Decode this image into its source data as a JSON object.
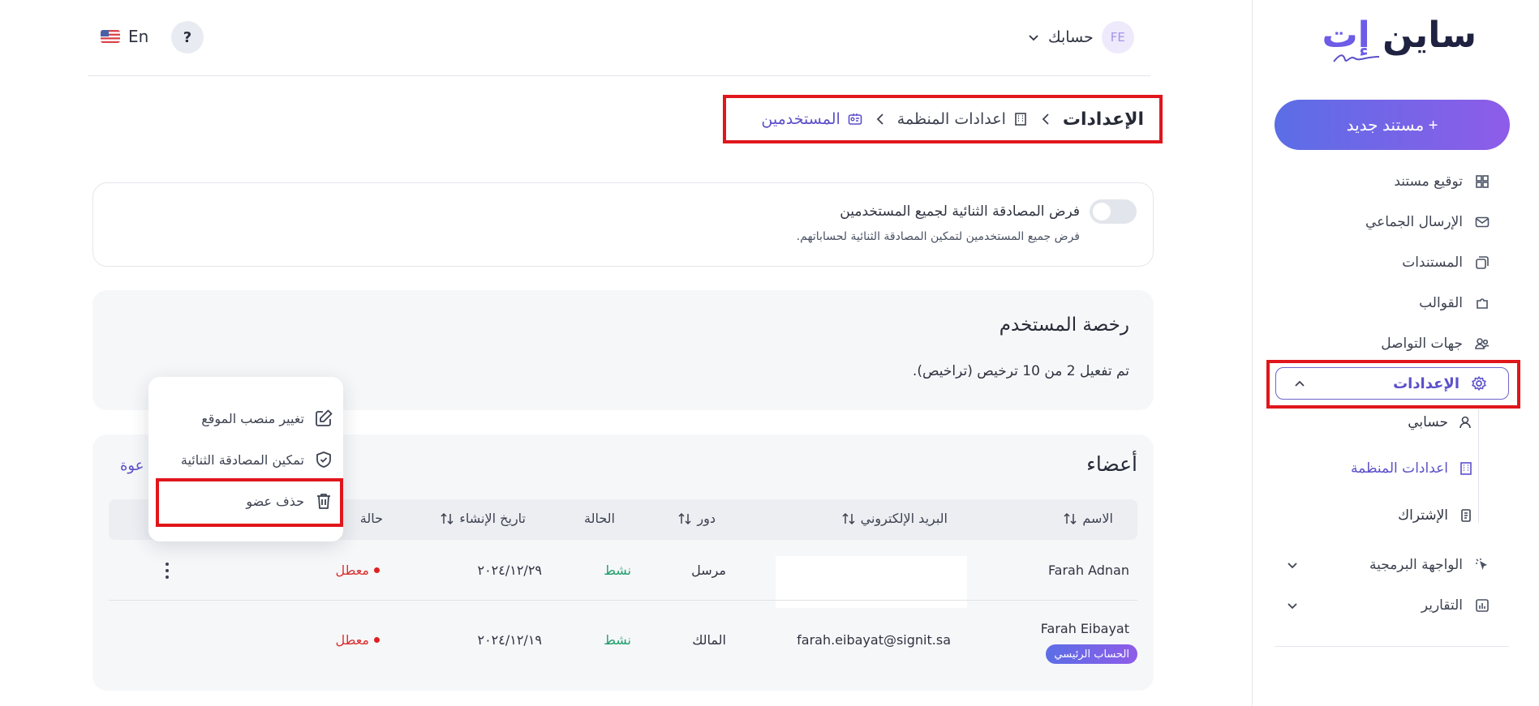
{
  "sidebar": {
    "logo_main": "ساين",
    "logo_accent": "إت",
    "new_document_label": "+ مستند جديد",
    "items": [
      {
        "label": "توقيع مستند",
        "icon": "grid-icon"
      },
      {
        "label": "الإرسال الجماعي",
        "icon": "envelope-icon"
      },
      {
        "label": "المستندات",
        "icon": "documents-icon"
      },
      {
        "label": "القوالب",
        "icon": "puzzle-icon"
      },
      {
        "label": "جهات التواصل",
        "icon": "contacts-icon"
      }
    ],
    "settings_label": "الإعدادات",
    "settings_sub": [
      {
        "label": "حسابي",
        "icon": "user-icon"
      },
      {
        "label": "اعدادات المنظمة",
        "icon": "building-icon"
      },
      {
        "label": "الإشتراك",
        "icon": "receipt-icon"
      }
    ],
    "api_label": "الواجهة البرمجية",
    "reports_label": "التقارير"
  },
  "topbar": {
    "language": "En",
    "help_symbol": "?",
    "account_label": "حسابك",
    "avatar_initials": "FE"
  },
  "breadcrumb": {
    "root": "الإعدادات",
    "org": "اعدادات المنظمة",
    "current": "المستخدمين"
  },
  "two_factor": {
    "title": "فرض المصادقة الثنائية لجميع المستخدمين",
    "description": "فرض جميع المستخدمين لتمكين المصادقة الثنائية لحساباتهم.",
    "enabled": false
  },
  "license": {
    "title": "رخصة المستخدم",
    "description": "تم تفعيل 2 من 10 ترخيص (تراخيص)."
  },
  "members": {
    "title": "أعضاء",
    "invite_partial": "عوة",
    "columns": {
      "name": "الاسم",
      "email": "البريد الإلكتروني",
      "role": "دور",
      "status": "الحالة",
      "created": "تاريخ الإنشاء",
      "twofa": "حالة"
    },
    "rows": [
      {
        "name": "Farah Adnan",
        "email": "",
        "role": "مرسل",
        "status": "نشط",
        "created": "٢٠٢٤/١٢/٢٩",
        "twofa": "معطل"
      },
      {
        "name": "Farah Eibayat",
        "email": "farah.eibayat@signit.sa",
        "role": "المالك",
        "status": "نشط",
        "created": "٢٠٢٤/١٢/١٩",
        "twofa": "معطل",
        "badge": "الحساب الرئيسي"
      }
    ]
  },
  "row_menu": {
    "change_role": "تغيير منصب الموقع",
    "enable_2fa": "تمكين المصادقة الثنائية",
    "delete_member": "حذف عضو"
  },
  "colors": {
    "accent": "#5b50c9",
    "highlight": "#e0161c",
    "active_green": "#1e9e6a",
    "disabled_red": "#d93131"
  }
}
